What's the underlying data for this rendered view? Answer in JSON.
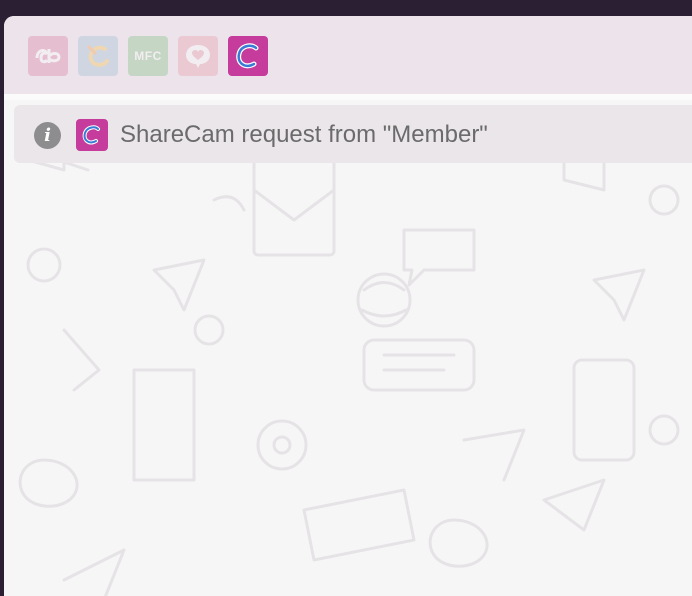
{
  "toolbar": {
    "apps": [
      {
        "name": "ChaturBate",
        "icon": "cb-logo-icon",
        "color": "#d97aa0",
        "active": false
      },
      {
        "name": "Cam4",
        "icon": "cam4-logo-icon",
        "color": "#9fbcd6",
        "active": false
      },
      {
        "name": "MyFreeCams",
        "label": "MFC",
        "icon": "mfc-logo-icon",
        "color": "#7fbf7f",
        "active": false
      },
      {
        "name": "Chat",
        "icon": "heart-speech-icon",
        "color": "#e89aa8",
        "active": false
      },
      {
        "name": "ShareCam",
        "icon": "sharecam-logo-icon",
        "color": "#c53c9c",
        "active": true
      }
    ]
  },
  "notification": {
    "icon": "info-icon",
    "app_icon": "sharecam-logo-icon",
    "text": "ShareCam request from \"Member\""
  },
  "colors": {
    "toolbar_bg": "#ece4ea",
    "notice_bg": "#ebe6ea",
    "window_frame": "#2a1f33",
    "sharecam_accent": "#c53c9c"
  }
}
